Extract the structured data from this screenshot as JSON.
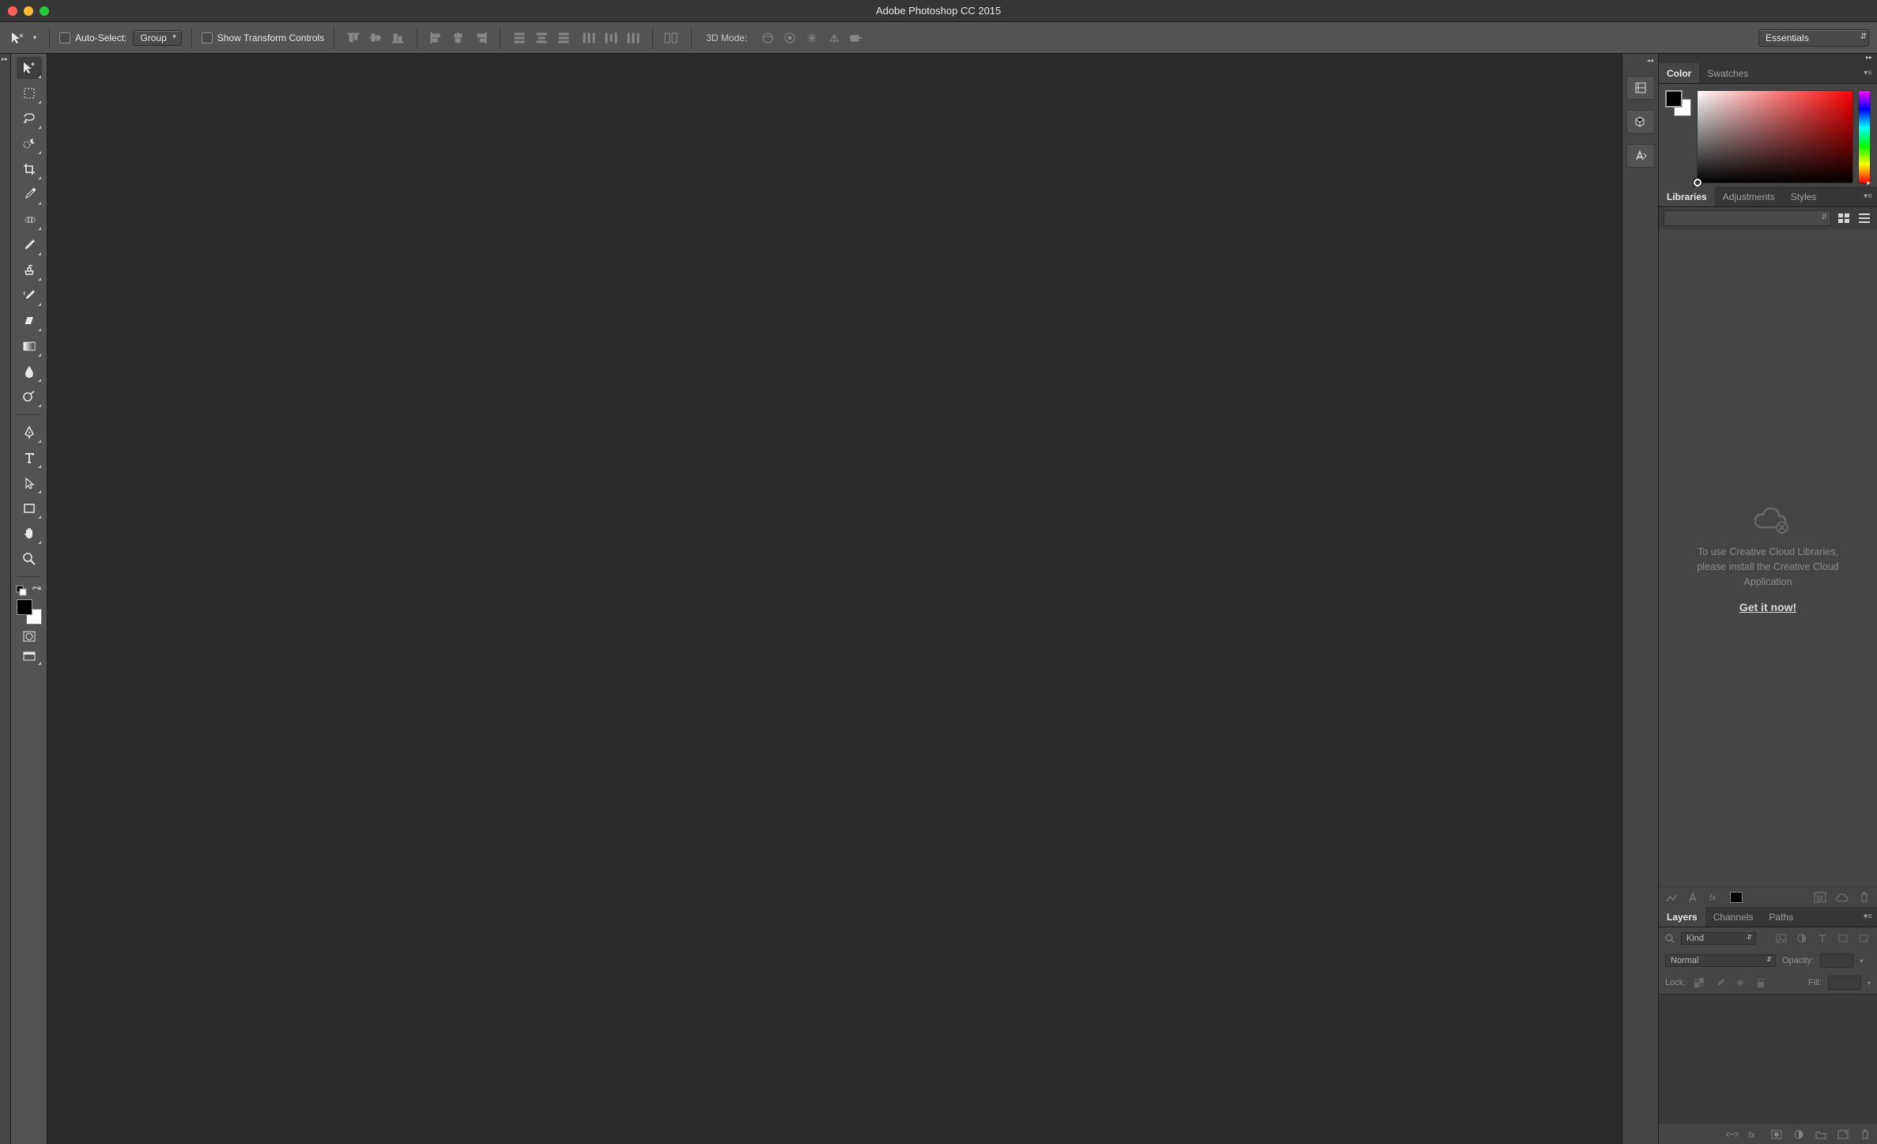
{
  "app_title": "Adobe Photoshop CC 2015",
  "optionsbar": {
    "auto_select_label": "Auto-Select:",
    "group_select_value": "Group",
    "show_transform_label": "Show Transform Controls",
    "mode3d_label": "3D Mode:"
  },
  "workspace_selector": "Essentials",
  "panels": {
    "color": {
      "tabs": [
        "Color",
        "Swatches"
      ],
      "active": 0,
      "fg": "#000000",
      "bg": "#ffffff"
    },
    "libraries": {
      "tabs": [
        "Libraries",
        "Adjustments",
        "Styles"
      ],
      "active": 0,
      "message_line1": "To use Creative Cloud Libraries,",
      "message_line2": "please install the Creative Cloud",
      "message_line3": "Application",
      "link_text": "Get it now!"
    },
    "layers": {
      "tabs": [
        "Layers",
        "Channels",
        "Paths"
      ],
      "active": 0,
      "kind_label": "Kind",
      "blend_mode": "Normal",
      "opacity_label": "Opacity:",
      "lock_label": "Lock:",
      "fill_label": "Fill:"
    }
  },
  "tools": [
    "move",
    "marquee",
    "lasso",
    "magic-wand",
    "crop",
    "eyedropper",
    "heal",
    "brush",
    "stamp",
    "history-brush",
    "eraser",
    "gradient",
    "blur",
    "dodge",
    "pen",
    "type",
    "path-select",
    "rectangle",
    "hand",
    "zoom"
  ]
}
